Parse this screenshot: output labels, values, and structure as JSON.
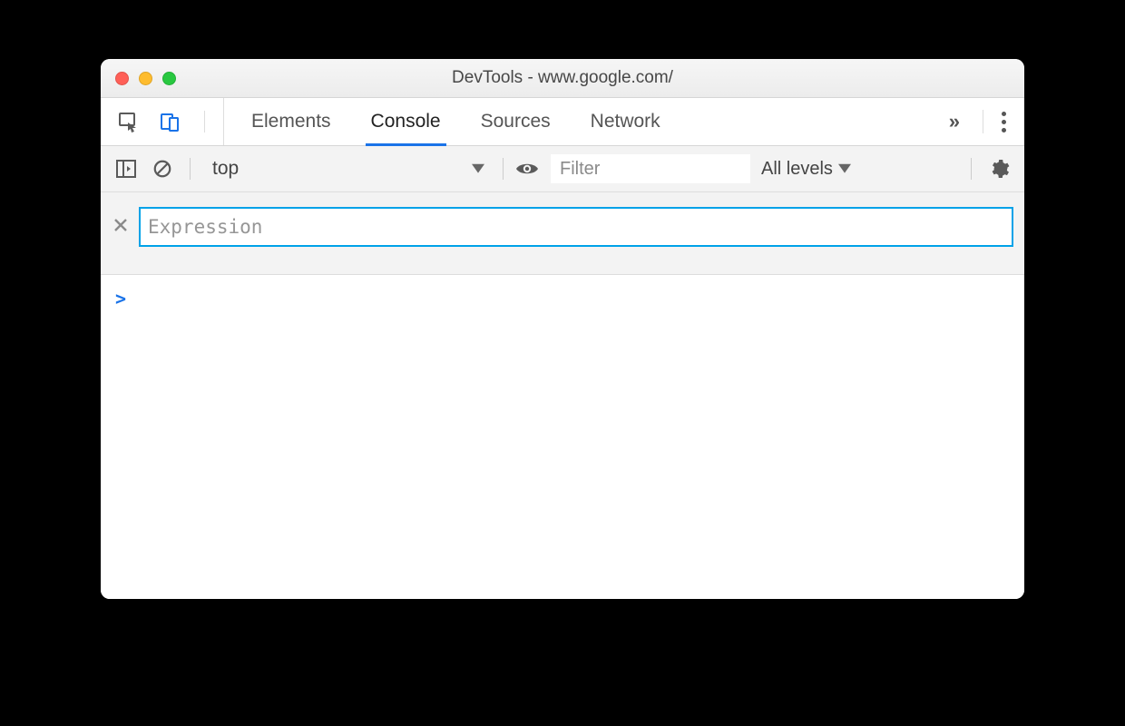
{
  "window": {
    "title": "DevTools - www.google.com/"
  },
  "tabs": {
    "elements": "Elements",
    "console": "Console",
    "sources": "Sources",
    "network": "Network",
    "active": "console"
  },
  "consoleToolbar": {
    "context": "top",
    "filter_placeholder": "Filter",
    "levels_label": "All levels"
  },
  "expression": {
    "placeholder": "Expression"
  },
  "prompt": {
    "symbol": ">"
  },
  "overflow_glyph": "»"
}
